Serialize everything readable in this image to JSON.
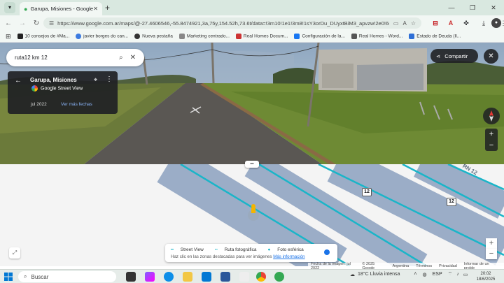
{
  "browser": {
    "tab_title": "Garupa, Misiones - Google Maps",
    "url": "https://www.google.com.ar/maps/@-27.4606546,-55.8474921,3a,75y,154.52h,73.6t/data=!3m10!1e1!3m8!1sY3orDu_DUyxtBiM3_apvzw!2e0!6shttps:...",
    "bookmarks": [
      {
        "label": "10 consejos de #Ma...",
        "color": "#222"
      },
      {
        "label": "javier borges do can...",
        "color": "#3c7be0"
      },
      {
        "label": "Nueva pestaña",
        "color": "#333"
      },
      {
        "label": "Marketing centrado...",
        "color": "#888"
      },
      {
        "label": "Real Homes Docum...",
        "color": "#c33"
      },
      {
        "label": "Configuración de la...",
        "color": "#1877f2"
      },
      {
        "label": "Real Homes - Word...",
        "color": "#555"
      },
      {
        "label": "Estado de Deuda (Il...",
        "color": "#2f6fd6"
      }
    ]
  },
  "streetview": {
    "search_query": "ruta12 km 12",
    "place_name": "Garupa, Misiones",
    "provider": "Google Street View",
    "capture_date": "jul 2022",
    "more_dates": "Ver más fechas",
    "share_label": "Compartir"
  },
  "map": {
    "route_number_1": "12",
    "route_number_2": "12",
    "road_label": "RN 12",
    "legend": {
      "street_view": "Street View",
      "photo_route": "Ruta fotográfica",
      "spherical_photo": "Foto esférica",
      "hint": "Haz clic en las zonas destacadas para ver imágenes",
      "more_info": "Más información"
    },
    "attribution": {
      "image_date": "Fecha de la imagen: jul 2022",
      "copyright": "© 2025 Google",
      "country": "Argentina",
      "terms": "Términos",
      "privacy": "Privacidad",
      "report": "Informar de un proble"
    }
  },
  "taskbar": {
    "search_placeholder": "Buscar",
    "weather": "18°C  Lluvia intensa",
    "language": "ESP",
    "time": "20:02",
    "date": "18/6/2025"
  },
  "colors": {
    "sv_line": "#1ab5c8",
    "road_band": "#7e96b8",
    "accent": "#1a73e8"
  }
}
